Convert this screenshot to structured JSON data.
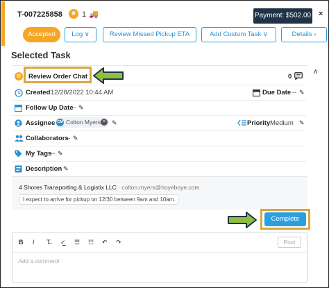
{
  "header": {
    "order_id": "T-007225858",
    "star_glyph": "★",
    "count": "1",
    "truck_glyph": "🚚",
    "payment": "Payment: $502.00",
    "close_glyph": "×",
    "status_badge": "Accepted",
    "buttons": [
      "Log ∨",
      "Review Missed Pickup ETA",
      "Add Custom Task ∨",
      "Details ›"
    ]
  },
  "section_title": "Selected Task",
  "task": {
    "title": "Review Order Chat",
    "chat_count": "0",
    "collapse_glyph": "∧",
    "created_label": "Created",
    "created_value": "12/28/2022 10:44 AM",
    "due_label": "Due Date",
    "due_value": "--",
    "follow_label": "Follow Up Date",
    "follow_value": "--",
    "assignee_label": "Assignee",
    "assignee_initials": "CM",
    "assignee_name": "Colton Myers",
    "priority_label": "Priority",
    "priority_value": "Medium",
    "collaborators_label": "Collaborators",
    "collaborators_value": "--",
    "tags_label": "My Tags",
    "tags_value": "--",
    "description_label": "Description"
  },
  "chat": {
    "company": "4 Shores Transporting & Logistix LLC",
    "email": "· colton.myers@hoyeboye.com",
    "message": "I expect to arrive for pickup on 12/30 between 9am and 10am."
  },
  "complete_label": "Complete",
  "editor": {
    "toolbar": [
      "B",
      "I",
      "T̶",
      "✓̲",
      "☰",
      "☷",
      "↶",
      "↷"
    ],
    "post_label": "Post",
    "placeholder": "Add a comment"
  },
  "colors": {
    "accent": "#f5a623",
    "primary": "#2b9fe0",
    "highlight": "#d9a741",
    "arrow": "#8fbf3f",
    "payment_bg": "#1f3346"
  }
}
